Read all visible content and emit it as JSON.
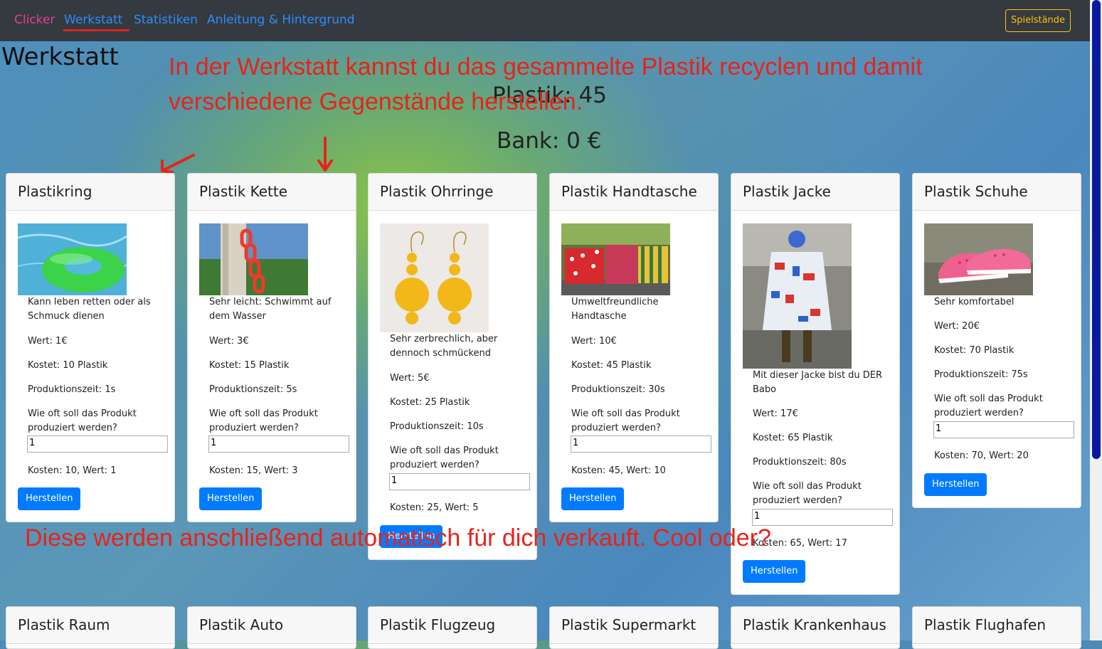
{
  "nav": {
    "brand": "Clicker",
    "links": [
      "Werkstatt",
      "Statistiken",
      "Anleitung & Hintergrund"
    ],
    "saves_button": "Spielstände"
  },
  "page": {
    "title": "Werkstatt",
    "plastik": "Plastik: 45",
    "bank": "Bank: 0 €"
  },
  "annotations": {
    "top": "In der Werkstatt kannst du das gesammelte Plastik recyclen und damit verschiedene Gegenstände herstellen.",
    "bottom": "Diese werden anschließend automatisch für dich verkauft. Cool oder?"
  },
  "products": [
    {
      "name": "Plastikring",
      "desc": "Kann leben retten oder als Schmuck dienen",
      "wert": "Wert: 1€",
      "kostet": "Kostet: 10 Plastik",
      "zeit": "Produktionszeit: 1s",
      "question": "Wie oft soll das Produkt produziert werden?",
      "qty": "1",
      "summary": "Kosten: 10, Wert: 1",
      "button": "Herstellen",
      "image": "swim-ring"
    },
    {
      "name": "Plastik Kette",
      "desc": "Sehr leicht: Schwimmt auf dem Wasser",
      "wert": "Wert: 3€",
      "kostet": "Kostet: 15 Plastik",
      "zeit": "Produktionszeit: 5s",
      "question": "Wie oft soll das Produkt produziert werden?",
      "qty": "1",
      "summary": "Kosten: 15, Wert: 3",
      "button": "Herstellen",
      "image": "plastic-chain"
    },
    {
      "name": "Plastik Ohrringe",
      "desc": "Sehr zerbrechlich, aber dennoch schmückend",
      "wert": "Wert: 5€",
      "kostet": "Kostet: 25 Plastik",
      "zeit": "Produktionszeit: 10s",
      "question": "Wie oft soll das Produkt produziert werden?",
      "qty": "1",
      "summary": "Kosten: 25, Wert: 5",
      "button": "Herstellen",
      "image": "yellow-earrings"
    },
    {
      "name": "Plastik Handtasche",
      "desc": "Umweltfreundliche Handtasche",
      "wert": "Wert: 10€",
      "kostet": "Kostet: 45 Plastik",
      "zeit": "Produktionszeit: 30s",
      "question": "Wie oft soll das Produkt produziert werden?",
      "qty": "1",
      "summary": "Kosten: 45, Wert: 10",
      "button": "Herstellen",
      "image": "handbags"
    },
    {
      "name": "Plastik Jacke",
      "desc": "Mit dieser Jacke bist du DER Babo",
      "wert": "Wert: 17€",
      "kostet": "Kostet: 65 Plastik",
      "zeit": "Produktionszeit: 80s",
      "question": "Wie oft soll das Produkt produziert werden?",
      "qty": "1",
      "summary": "Kosten: 65, Wert: 17",
      "button": "Herstellen",
      "image": "plastic-jacket"
    },
    {
      "name": "Plastik Schuhe",
      "desc": "Sehr komfortabel",
      "wert": "Wert: 20€",
      "kostet": "Kostet: 70 Plastik",
      "zeit": "Produktionszeit: 75s",
      "question": "Wie oft soll das Produkt produziert werden?",
      "qty": "1",
      "summary": "Kosten: 70, Wert: 20",
      "button": "Herstellen",
      "image": "pink-shoes"
    }
  ],
  "products_row2": [
    "Plastik Raum",
    "Plastik Auto",
    "Plastik Flugzeug",
    "Plastik Supermarkt",
    "Plastik Krankenhaus",
    "Plastik Flughafen"
  ]
}
